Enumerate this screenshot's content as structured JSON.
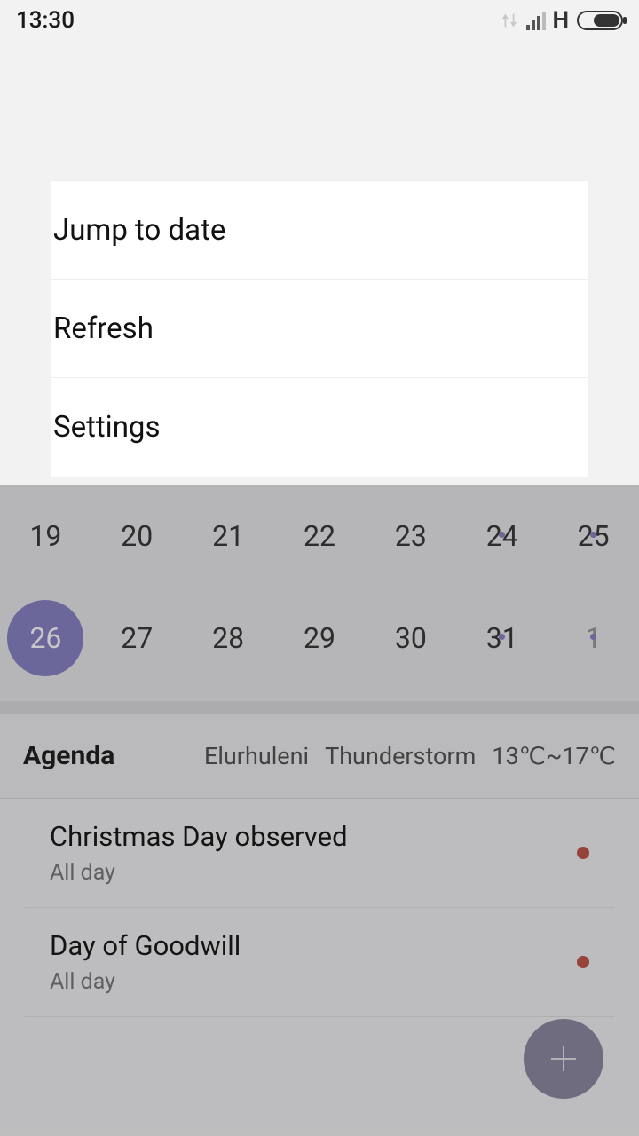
{
  "status": {
    "time": "13:30",
    "network_type": "H"
  },
  "menu": {
    "items": [
      {
        "label": "Jump to date"
      },
      {
        "label": "Refresh"
      },
      {
        "label": "Settings"
      }
    ]
  },
  "calendar": {
    "rows": [
      [
        {
          "day": "19",
          "selected": false,
          "has_event": false,
          "muted": false
        },
        {
          "day": "20",
          "selected": false,
          "has_event": false,
          "muted": false
        },
        {
          "day": "21",
          "selected": false,
          "has_event": false,
          "muted": false
        },
        {
          "day": "22",
          "selected": false,
          "has_event": false,
          "muted": false
        },
        {
          "day": "23",
          "selected": false,
          "has_event": false,
          "muted": false
        },
        {
          "day": "24",
          "selected": false,
          "has_event": true,
          "muted": false
        },
        {
          "day": "25",
          "selected": false,
          "has_event": true,
          "muted": false
        }
      ],
      [
        {
          "day": "26",
          "selected": true,
          "has_event": false,
          "muted": false
        },
        {
          "day": "27",
          "selected": false,
          "has_event": false,
          "muted": false
        },
        {
          "day": "28",
          "selected": false,
          "has_event": false,
          "muted": false
        },
        {
          "day": "29",
          "selected": false,
          "has_event": false,
          "muted": false
        },
        {
          "day": "30",
          "selected": false,
          "has_event": false,
          "muted": false
        },
        {
          "day": "31",
          "selected": false,
          "has_event": true,
          "muted": false
        },
        {
          "day": "1",
          "selected": false,
          "has_event": true,
          "muted": true
        }
      ]
    ]
  },
  "agenda": {
    "title": "Agenda",
    "location": "Elurhuleni",
    "condition": "Thunderstorm",
    "temp_range": "13℃~17℃",
    "items": [
      {
        "title": "Christmas Day observed",
        "sub": "All day"
      },
      {
        "title": "Day of Goodwill",
        "sub": "All day"
      }
    ]
  }
}
